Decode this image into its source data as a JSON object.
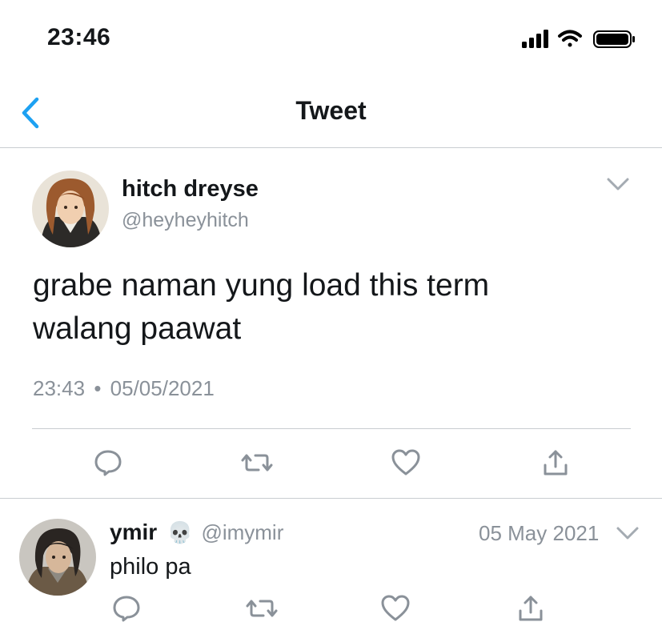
{
  "status_bar": {
    "time": "23:46"
  },
  "nav": {
    "title": "Tweet",
    "back_icon": "chevron-left-icon"
  },
  "colors": {
    "accent": "#1da1f2",
    "muted": "#8a9199",
    "text": "#14171a",
    "divider": "#c9cdd1"
  },
  "tweet": {
    "author_name": "hitch dreyse",
    "author_handle": "@heyheyhitch",
    "text_line1": "grabe naman yung load this term",
    "text_line2": "walang paawat",
    "time": "23:43",
    "separator": "•",
    "date": "05/05/2021",
    "actions": [
      "reply-icon",
      "retweet-icon",
      "like-icon",
      "share-icon"
    ]
  },
  "reply": {
    "author_name": "ymir",
    "emoji": "💀",
    "author_handle": "@imymir",
    "date": "05 May 2021",
    "text": "philo pa",
    "actions": [
      "reply-icon",
      "retweet-icon",
      "like-icon",
      "share-icon"
    ]
  }
}
